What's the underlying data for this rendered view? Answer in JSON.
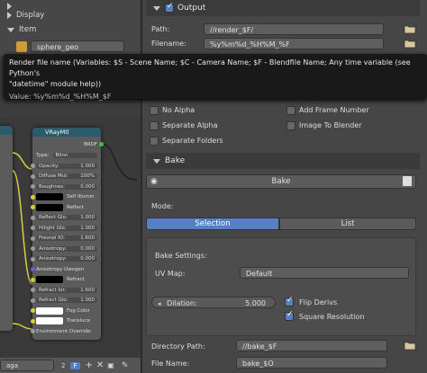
{
  "left_panel": {
    "display_label": "Display",
    "item_label": "Item",
    "object_name": "sphere_geo"
  },
  "node": {
    "title": "VRayMtl",
    "output": "BRDF",
    "type_label": "Type:",
    "type_value": "Blinn",
    "rows": [
      {
        "label": "Opacity:",
        "value": "1.000"
      },
      {
        "label": "Diffuse Mul:",
        "value": "100%"
      },
      {
        "label": "Roughnes:",
        "value": "0.000"
      },
      {
        "label": "Self Illumin",
        "swatch": "black"
      },
      {
        "label": "Reflect",
        "swatch": "black"
      },
      {
        "label": "Reflect Glo:",
        "value": "1.000"
      },
      {
        "label": "Hilight Glo:",
        "value": "1.000"
      },
      {
        "label": "Fresnel IO:",
        "value": "1.600"
      },
      {
        "label": "Anisotropy:",
        "value": "0.000"
      },
      {
        "label": "Anisotropy:",
        "value": "0.000"
      },
      {
        "label": "Anisotropy Uwvgen",
        "plain": true
      },
      {
        "label": "Refract",
        "swatch": "black"
      },
      {
        "label": "Refract Ior:",
        "value": "1.600"
      },
      {
        "label": "Refract Glo:",
        "value": "1.000"
      },
      {
        "label": "Fog Color",
        "swatch": "white"
      },
      {
        "label": "Transluce",
        "swatch": "white"
      },
      {
        "label": "Environment Override",
        "plain": true
      }
    ]
  },
  "bottom_bar": {
    "name_field": "aga",
    "users_count": "2",
    "fake_user": "F"
  },
  "output_section": {
    "title": "Output",
    "path_label": "Path:",
    "path_value": "//render_$F/",
    "filename_label": "Filename:",
    "filename_value": "%y%m%d_%H%M_%F",
    "checkboxes": [
      {
        "label": "No Alpha",
        "checked": false
      },
      {
        "label": "Add Frame Number",
        "checked": false
      },
      {
        "label": "Separate Alpha",
        "checked": false
      },
      {
        "label": "Image To Blender",
        "checked": false
      },
      {
        "label": "Separate Folders",
        "checked": false
      }
    ]
  },
  "tooltip": {
    "line1": "Render file name (Variables: $S - Scene Name; $C - Camera Name; $F - Blendfile Name; Any time variable (see Python's",
    "line2": "\"datetime\" module help))",
    "line3": "Value: %y%m%d_%H%M_$F"
  },
  "bake_section": {
    "title": "Bake",
    "bake_button": "Bake",
    "mode_label": "Mode:",
    "mode_selection": "Selection",
    "mode_list": "List",
    "settings_label": "Bake Settings:",
    "uv_map_label": "UV Map:",
    "uv_map_value": "Default",
    "dilation_label": "Dilation:",
    "dilation_value": "5.000",
    "flip_derivs_label": "Flip Derivs",
    "flip_derivs_checked": true,
    "square_res_label": "Square Resolution",
    "square_res_checked": true,
    "directory_label": "Directory Path:",
    "directory_value": "//bake_$F",
    "filename_label": "File Name:",
    "filename_value": "bake_$O"
  },
  "colors": {
    "accent_blue": "#5680c2",
    "node_header": "#2a5b6a",
    "tooltip_bg": "#191919"
  }
}
